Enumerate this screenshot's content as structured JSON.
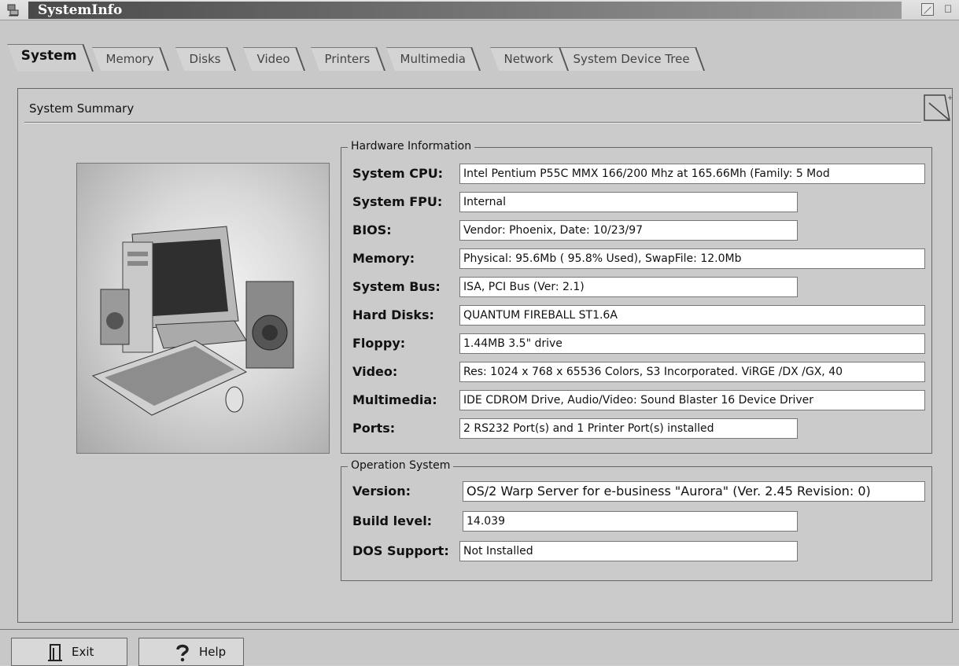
{
  "window": {
    "title": "SystemInfo"
  },
  "tabs": [
    {
      "label": "System",
      "active": true
    },
    {
      "label": "Memory"
    },
    {
      "label": "Disks"
    },
    {
      "label": "Video"
    },
    {
      "label": "Printers"
    },
    {
      "label": "Multimedia"
    },
    {
      "label": "Network"
    },
    {
      "label": "System Device Tree"
    }
  ],
  "panel": {
    "title": "System Summary"
  },
  "hardware": {
    "group_label": "Hardware Information",
    "rows": [
      {
        "label": "System CPU:",
        "value": "Intel Pentium P55C MMX 166/200 Mhz at 165.66Mh (Family: 5 Mod"
      },
      {
        "label": "System FPU:",
        "value": "Internal"
      },
      {
        "label": "BIOS:",
        "value": "Vendor: Phoenix, Date: 10/23/97"
      },
      {
        "label": "Memory:",
        "value": "Physical:   95.6Mb ( 95.8% Used), SwapFile:   12.0Mb"
      },
      {
        "label": "System Bus:",
        "value": "ISA, PCI Bus (Ver: 2.1)"
      },
      {
        "label": "Hard Disks:",
        "value": "QUANTUM FIREBALL ST1.6A"
      },
      {
        "label": "Floppy:",
        "value": "1.44MB 3.5\" drive"
      },
      {
        "label": "Video:",
        "value": "Res: 1024 x 768 x 65536 Colors, S3 Incorporated. ViRGE /DX /GX,  40"
      },
      {
        "label": "Multimedia:",
        "value": "IDE CDROM Drive, Audio/Video: Sound Blaster 16 Device Driver"
      },
      {
        "label": "Ports:",
        "value": "2 RS232 Port(s) and 1 Printer Port(s) installed"
      }
    ]
  },
  "os": {
    "group_label": "Operation System",
    "rows": [
      {
        "label": "Version:",
        "value": "OS/2 Warp Server for e-business \"Aurora\" (Ver. 2.45 Revision: 0)"
      },
      {
        "label": "Build level:",
        "value": "14.039"
      },
      {
        "label": "DOS Support:",
        "value": "Not Installed"
      }
    ]
  },
  "buttons": {
    "exit": "Exit",
    "help": "Help"
  },
  "icons": {
    "title": "app-icon",
    "corner": "notepad-corner-icon",
    "exit": "exit-door-icon",
    "help": "question-mark-icon",
    "picture": "computer-picture"
  }
}
